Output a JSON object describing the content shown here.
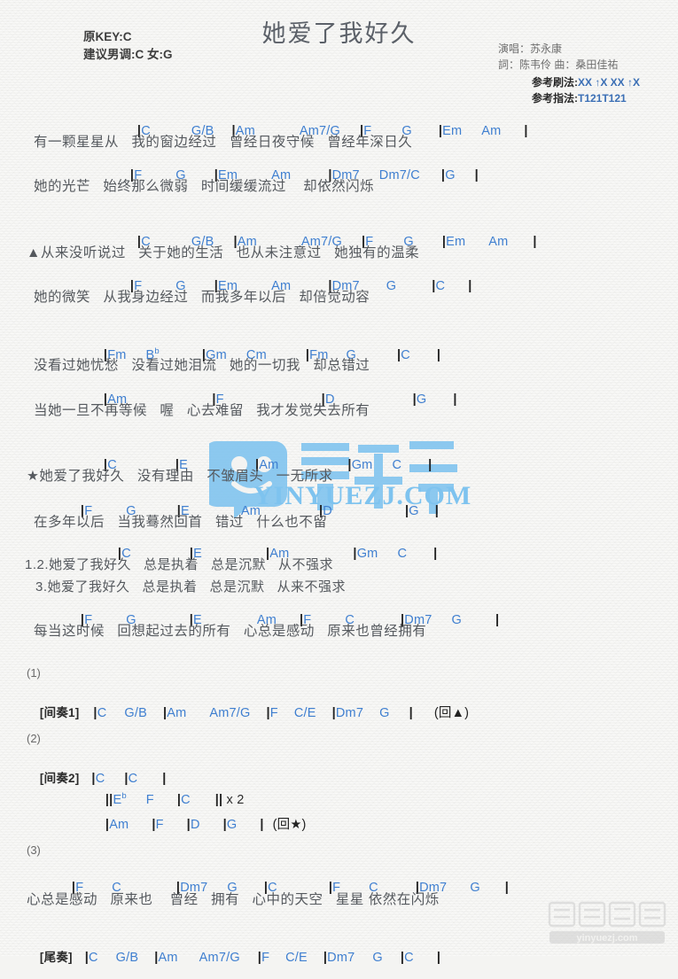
{
  "header": {
    "title": "她爱了我好久",
    "orig_key": "原KEY:C",
    "suggest_key": "建议男调:C 女:G",
    "singer": "演唱：苏永康",
    "credits": "詞：陈韦伶  曲：桑田佳祐",
    "strum_label": "参考刷法:",
    "strum_value": "XX ↑X XX ↑X",
    "fingering_label": "参考指法:",
    "fingering_value": "T121T121"
  },
  "watermark": {
    "main_text": "音乐之家",
    "main_url": "YINYUEZJ.COM",
    "corner_text": "音乐之家",
    "corner_url": "yinyuezj.com"
  },
  "verse1": {
    "chords_a": [
      "|C",
      "G/B",
      "|Am",
      "Am7/G",
      "|F",
      "G",
      "|Em",
      "Am",
      "|"
    ],
    "lyric_a": "有一颗星星从   我的窗边经过   曾经日夜守候   曾经年深日久",
    "chords_b": [
      "|F",
      "G",
      "|Em",
      "Am",
      "|Dm7",
      "Dm7/C",
      "|G",
      "|"
    ],
    "lyric_b": "她的光芒   始终那么微弱   时间缓缓流过    却依然闪烁"
  },
  "verse2": {
    "chords_a": [
      "|C",
      "G/B",
      "|Am",
      "Am7/G",
      "|F",
      "G",
      "|Em",
      "Am",
      "|"
    ],
    "lyric_a": "▲从来没听说过   关于她的生活   也从未注意过   她独有的温柔",
    "chords_b": [
      "|F",
      "G",
      "|Em",
      "Am",
      "|Dm7",
      "G",
      "|C",
      "|"
    ],
    "lyric_b": "她的微笑   从我身边经过   而我多年以后   却倍觉动容"
  },
  "verse3": {
    "chords_a": [
      "|Fm",
      "Bb",
      "|Gm",
      "Cm",
      "|Fm",
      "G",
      "|C",
      "|"
    ],
    "lyric_a": "没看过她忧愁   没看过她泪流   她的一切我   却总错过",
    "chords_b": [
      "|Am",
      "|F",
      "|D",
      "|G",
      "|"
    ],
    "lyric_b": "当她一旦不再等候   喔   心去难留   我才发觉失去所有"
  },
  "chorus": {
    "chords_a": [
      "|C",
      "|E",
      "|Am",
      "|Gm",
      "C",
      "|"
    ],
    "lyric_a": "★她爱了我好久   没有理由   不皱眉头   一无所求",
    "chords_b": [
      "|F",
      "G",
      "|E",
      "Am",
      "|D",
      "|G",
      "|"
    ],
    "lyric_b": "在多年以后   当我蓦然回首   错过   什么也不留"
  },
  "chorus2": {
    "chords_a": [
      "|C",
      "|E",
      "|Am",
      "|Gm",
      "C",
      "|"
    ],
    "lyric_a": "1.2.她爱了我好久   总是执着   总是沉默   从不强求",
    "lyric_a2": "3.她爱了我好久   总是执着   总是沉默   从来不强求",
    "chords_b": [
      "|F",
      "G",
      "|E",
      "Am",
      "|F",
      "C",
      "|Dm7",
      "G",
      "|"
    ],
    "lyric_b": "每当这时候   回想起过去的所有   心总是感动   原来也曾经拥有"
  },
  "interlude1": {
    "number": "(1)",
    "label": "[间奏1]",
    "chords": [
      "|C",
      "G/B",
      "|Am",
      "Am7/G",
      "|F",
      "C/E",
      "|Dm7",
      "G",
      "|",
      "(回▲)"
    ]
  },
  "interlude2": {
    "number": "(2)",
    "label": "[间奏2]",
    "line1": [
      "|C",
      "|C",
      "|"
    ],
    "line2": [
      "||Eb",
      "F",
      "|C",
      "|| x 2"
    ],
    "line3": [
      "|Am",
      "|F",
      "|D",
      "|G",
      "|",
      "(回★)"
    ]
  },
  "outro": {
    "number": "(3)",
    "chords": [
      "|F",
      "C",
      "|Dm7",
      "G",
      "|C",
      "|F",
      "C",
      "|Dm7",
      "G",
      "|"
    ],
    "lyric": "心总是感动   原来也    曾经   拥有   心中的天空   星星 依然在闪烁",
    "coda_label": "[尾奏]",
    "coda_chords": [
      "|C",
      "G/B",
      "|Am",
      "Am7/G",
      "|F",
      "C/E",
      "|Dm7",
      "G",
      "|C",
      "|"
    ]
  }
}
